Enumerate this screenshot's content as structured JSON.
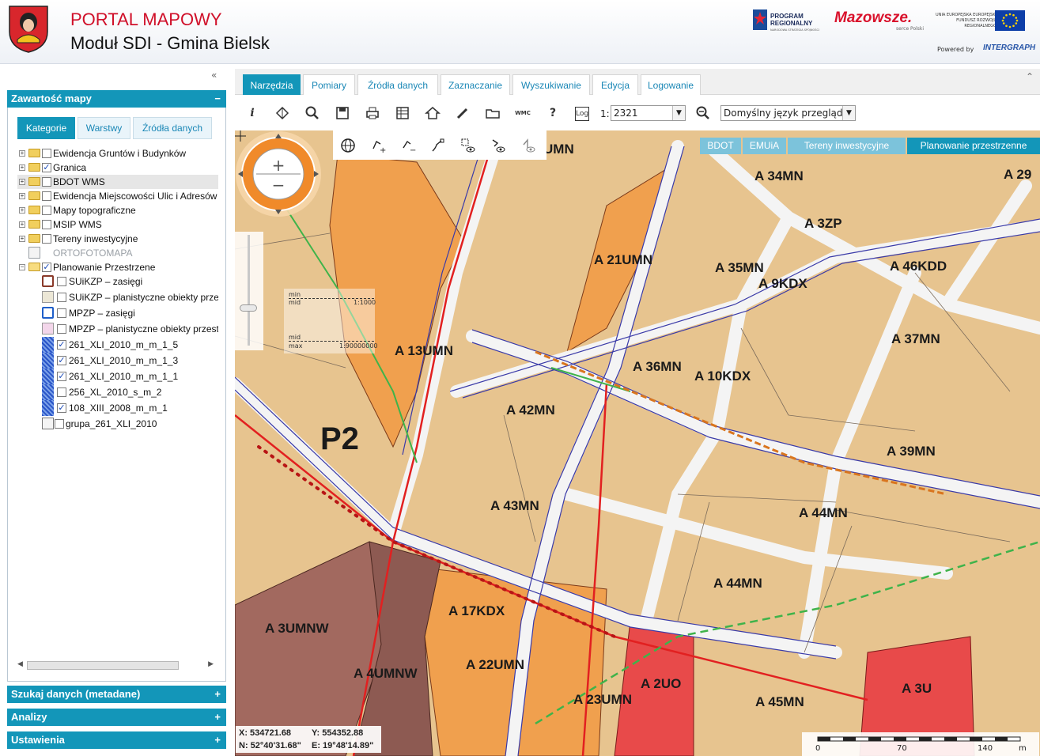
{
  "header": {
    "title": "PORTAL MAPOWY",
    "subtitle": "Moduł SDI - Gmina Bielsk",
    "logos": {
      "program_line1": "PROGRAM",
      "program_line2": "REGIONALNY",
      "program_line3": "NARODOWA STRATEGIA SPÓJNOŚCI",
      "mazowsze": "Mazowsze.",
      "mazowsze_sub": "serce Polski",
      "ue_text": "UNIA EUROPEJSKA EUROPEJSKI FUNDUSZ ROZWOJU REGIONALNEGO",
      "powered_by": "Powered by",
      "intergraph": "INTERGRAPH"
    }
  },
  "colors": {
    "accent": "#1396b9",
    "title_red": "#d0102a",
    "zone_orange": "#f0a04e",
    "zone_beige": "#e7c48f",
    "zone_brown": "#a2695f",
    "zone_red": "#e84a4a"
  },
  "left_panel": {
    "content_header": "Zawartość mapy",
    "content_toggle": "−",
    "collapse_icon": "«",
    "subtabs": [
      "Kategorie",
      "Warstwy",
      "Źródła danych"
    ],
    "tree": [
      {
        "label": "Ewidencja Gruntów i Budynków",
        "checked": false
      },
      {
        "label": "Granica",
        "checked": true
      },
      {
        "label": "BDOT WMS",
        "checked": false
      },
      {
        "label": "Ewidencja Miejscowości Ulic i Adresów",
        "checked": false
      },
      {
        "label": "Mapy topograficzne",
        "checked": false
      },
      {
        "label": "MSIP WMS",
        "checked": false
      },
      {
        "label": "Tereny inwestycyjne",
        "checked": false
      },
      {
        "label": "ORTOFOTOMAPA",
        "checked": false
      },
      {
        "label": "Planowanie Przestrzene",
        "checked": true
      },
      {
        "label": "SUiKZP – zasięgi",
        "checked": false
      },
      {
        "label": "SUiKZP – planistyczne obiekty przestrzenne",
        "checked": false
      },
      {
        "label": "MPZP – zasięgi",
        "checked": false
      },
      {
        "label": "MPZP – planistyczne obiekty przestrzenne",
        "checked": false
      },
      {
        "label": "261_XLI_2010_m_m_1_5",
        "checked": true
      },
      {
        "label": "261_XLI_2010_m_m_1_3",
        "checked": true
      },
      {
        "label": "261_XLI_2010_m_m_1_1",
        "checked": true
      },
      {
        "label": "256_XL_2010_s_m_2",
        "checked": false
      },
      {
        "label": "108_XIII_2008_m_m_1",
        "checked": true
      },
      {
        "label": "grupa_261_XLI_2010",
        "checked": false
      }
    ],
    "sections": [
      {
        "label": "Szukaj danych (metadane)",
        "toggle": "+"
      },
      {
        "label": "Analizy",
        "toggle": "+"
      },
      {
        "label": "Ustawienia",
        "toggle": "+"
      }
    ]
  },
  "tabs": [
    "Narzędzia",
    "Pomiary",
    "Źródła danych",
    "Zaznaczanie",
    "Wyszukiwanie",
    "Edycja",
    "Logowanie"
  ],
  "tabs_collapse_icon": "⌃",
  "toolbar": {
    "scale_prefix": "1:",
    "scale_value": "2321",
    "language": "Domyślny język przeglądarki",
    "icons": [
      "info-icon",
      "layers-icon",
      "zoom-icon",
      "save-icon",
      "print-icon",
      "table-icon",
      "home-icon",
      "pencil-icon",
      "folder-icon",
      "wmc-icon",
      "help-icon",
      "log-icon",
      "zoom-scale-icon"
    ],
    "help_glyph": "?",
    "info_glyph": "i",
    "wmc_text": "WMC",
    "log_text": "Log"
  },
  "map": {
    "layer_buttons": [
      "BDOT",
      "EMUiA",
      "Tereny inwestycyjne",
      "Planowanie przestrzenne"
    ],
    "active_layer_button": "Planowanie przestrzenne",
    "scale_legend": {
      "min": "min",
      "mid": "mid",
      "mid_value": "1:1000",
      "max": "max",
      "max_value": "1:90000000"
    },
    "coords": {
      "x": "X: 534721.68",
      "y": "Y: 554352.88",
      "n": "N: 52°40'31.68\"",
      "e": "E: 19°48'14.89\""
    },
    "scalebar": {
      "ticks": [
        "0",
        "70",
        "140"
      ],
      "unit": "m"
    },
    "labels": [
      {
        "text": "A 34MN"
      },
      {
        "text": "A 3ZP"
      },
      {
        "text": "A 21UMN"
      },
      {
        "text": "A 35MN"
      },
      {
        "text": "A 9KDX"
      },
      {
        "text": "A 46KDD"
      },
      {
        "text": "A 13UMN"
      },
      {
        "text": "A 37MN"
      },
      {
        "text": "A 36MN"
      },
      {
        "text": "A 10KDX"
      },
      {
        "text": "A 42MN"
      },
      {
        "text": "A 39MN"
      },
      {
        "text": "A 43MN"
      },
      {
        "text": "A 44MN"
      },
      {
        "text": "A 44MN"
      },
      {
        "text": "A 17KDX"
      },
      {
        "text": "A 22UMN"
      },
      {
        "text": "A 3UMNW"
      },
      {
        "text": "A 4UMNW"
      },
      {
        "text": "A 2UO"
      },
      {
        "text": "A 23UMN"
      },
      {
        "text": "A 3U"
      },
      {
        "text": "A 45MN"
      },
      {
        "text": "A 29"
      },
      {
        "text": "P2"
      },
      {
        "text": "UMN"
      }
    ]
  }
}
